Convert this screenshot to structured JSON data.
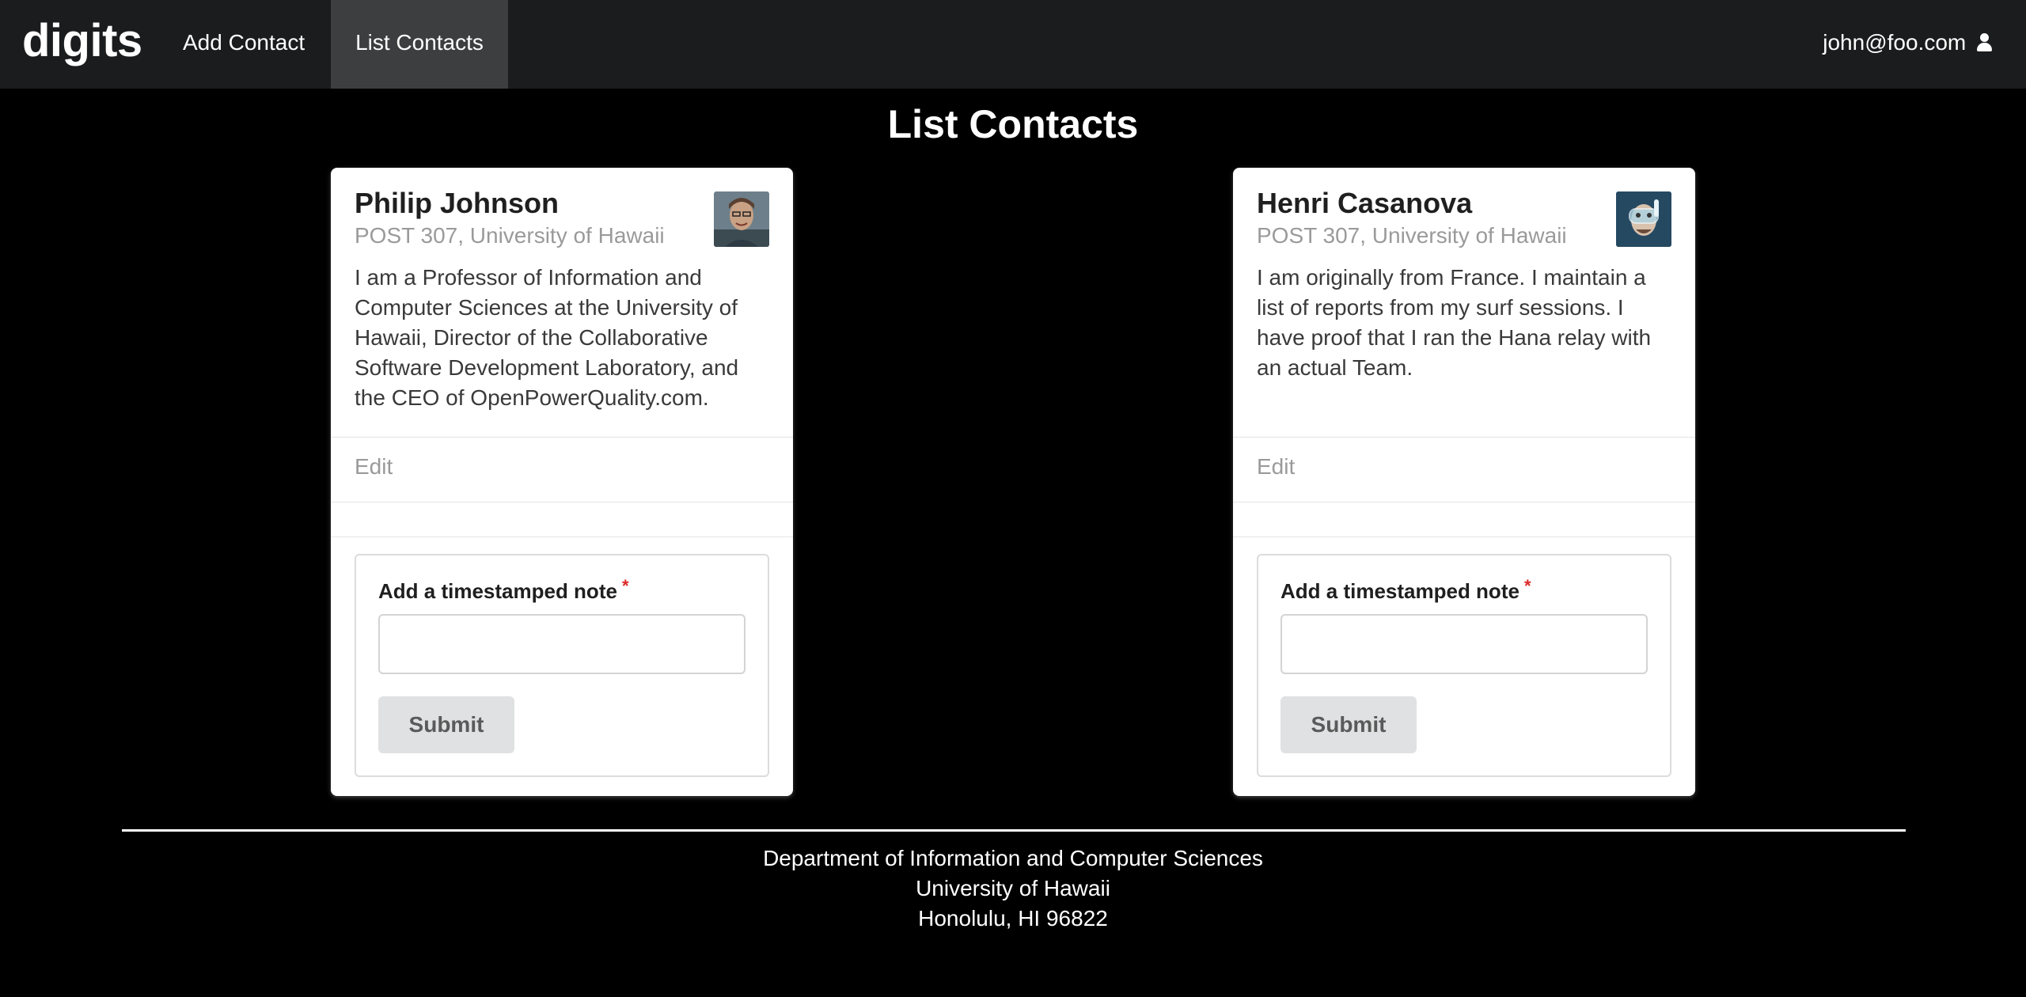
{
  "navbar": {
    "brand": "digits",
    "items": [
      {
        "label": "Add Contact",
        "active": false
      },
      {
        "label": "List Contacts",
        "active": true
      }
    ],
    "user": "john@foo.com",
    "user_icon": "user-icon"
  },
  "page": {
    "title": "List Contacts"
  },
  "contacts": [
    {
      "name": "Philip Johnson",
      "address": "POST 307, University of Hawaii",
      "description": "I am a Professor of Information and Computer Sciences at the University of Hawaii, Director of the Collaborative Software Development Laboratory, and the CEO of OpenPowerQuality.com.",
      "edit_label": "Edit",
      "note_label": "Add a timestamped note",
      "note_value": "",
      "submit_label": "Submit"
    },
    {
      "name": "Henri Casanova",
      "address": "POST 307, University of Hawaii",
      "description": "I am originally from France. I maintain a list of reports from my surf sessions. I have proof that I ran the Hana relay with an actual Team.",
      "edit_label": "Edit",
      "note_label": "Add a timestamped note",
      "note_value": "",
      "submit_label": "Submit"
    }
  ],
  "footer": {
    "line1": "Department of Information and Computer Sciences",
    "line2": "University of Hawaii",
    "line3": "Honolulu, HI 96822"
  },
  "colors": {
    "page_background": "#000000",
    "navbar_background": "#1b1c1d",
    "active_nav_background": "#3d3e3f",
    "required_star": "#db2828",
    "button_background": "#e0e1e2"
  }
}
